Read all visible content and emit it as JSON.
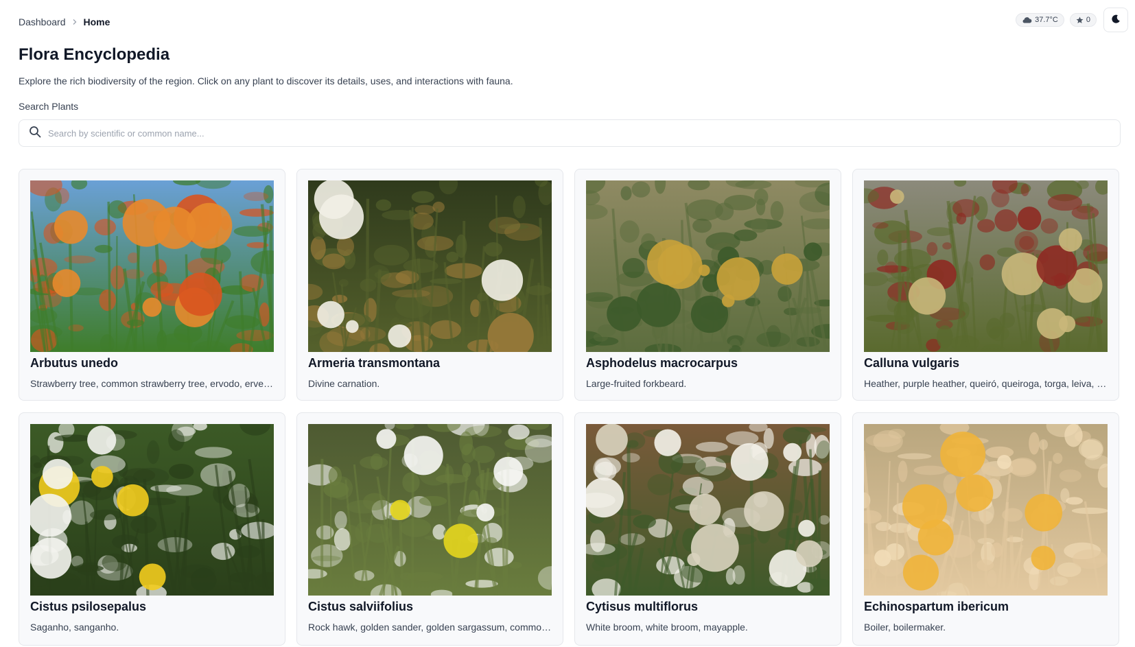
{
  "breadcrumb": {
    "parent": "Dashboard",
    "current": "Home"
  },
  "status": {
    "temperature": "37.7°C",
    "favorites": "0"
  },
  "icons": {
    "weather": "cloud-icon",
    "favorites": "star-icon",
    "theme": "moon-icon",
    "search": "search-icon",
    "separator": "chevron-right-icon"
  },
  "header": {
    "title": "Flora Encyclopedia",
    "subtitle": "Explore the rich biodiversity of the region. Click on any plant to discover its details, uses, and interactions with fauna."
  },
  "search": {
    "label": "Search Plants",
    "placeholder": "Search by scientific or common name...",
    "value": ""
  },
  "plants": [
    {
      "name": "Arbutus unedo",
      "common": "Strawberry tree, common strawberry tree, ervodo, ervedeiro, medronheiro.",
      "palette": [
        "#6aa0d6",
        "#3f7d2a",
        "#d9541f",
        "#e88a2c"
      ]
    },
    {
      "name": "Armeria transmontana",
      "common": "Divine carnation.",
      "palette": [
        "#2f3a1c",
        "#55612c",
        "#9a7a3a",
        "#f2f0e6"
      ]
    },
    {
      "name": "Asphodelus macrocarpus",
      "common": "Large-fruited forkbeard.",
      "palette": [
        "#8f8a63",
        "#5c6d3e",
        "#3c5a2a",
        "#c9a23a"
      ]
    },
    {
      "name": "Calluna vulgaris",
      "common": "Heather, purple heather, queiró, queiroga, torga, leiva, urze.",
      "palette": [
        "#8c8a7c",
        "#5a6a2e",
        "#8e2a22",
        "#c9b77a"
      ]
    },
    {
      "name": "Cistus psilosepalus",
      "common": "Saganho, sanganho.",
      "palette": [
        "#3c5a26",
        "#2a3f1a",
        "#f4f4f0",
        "#f2cc1e"
      ]
    },
    {
      "name": "Cistus salviifolius",
      "common": "Rock hawk, golden sander, golden sargassum, common sun rose.",
      "palette": [
        "#4e5a32",
        "#6a7d3e",
        "#f7f7f5",
        "#e5d61e"
      ]
    },
    {
      "name": "Cytisus multiflorus",
      "common": "White broom, white broom, mayapple.",
      "palette": [
        "#7a5a3a",
        "#3e5a2a",
        "#f4f2ea",
        "#d9d3bf"
      ]
    },
    {
      "name": "Echinospartum ibericum",
      "common": "Boiler, boilermaker.",
      "palette": [
        "#b9a67e",
        "#e3c9a0",
        "#f2ddb8",
        "#f0b43a"
      ]
    }
  ]
}
